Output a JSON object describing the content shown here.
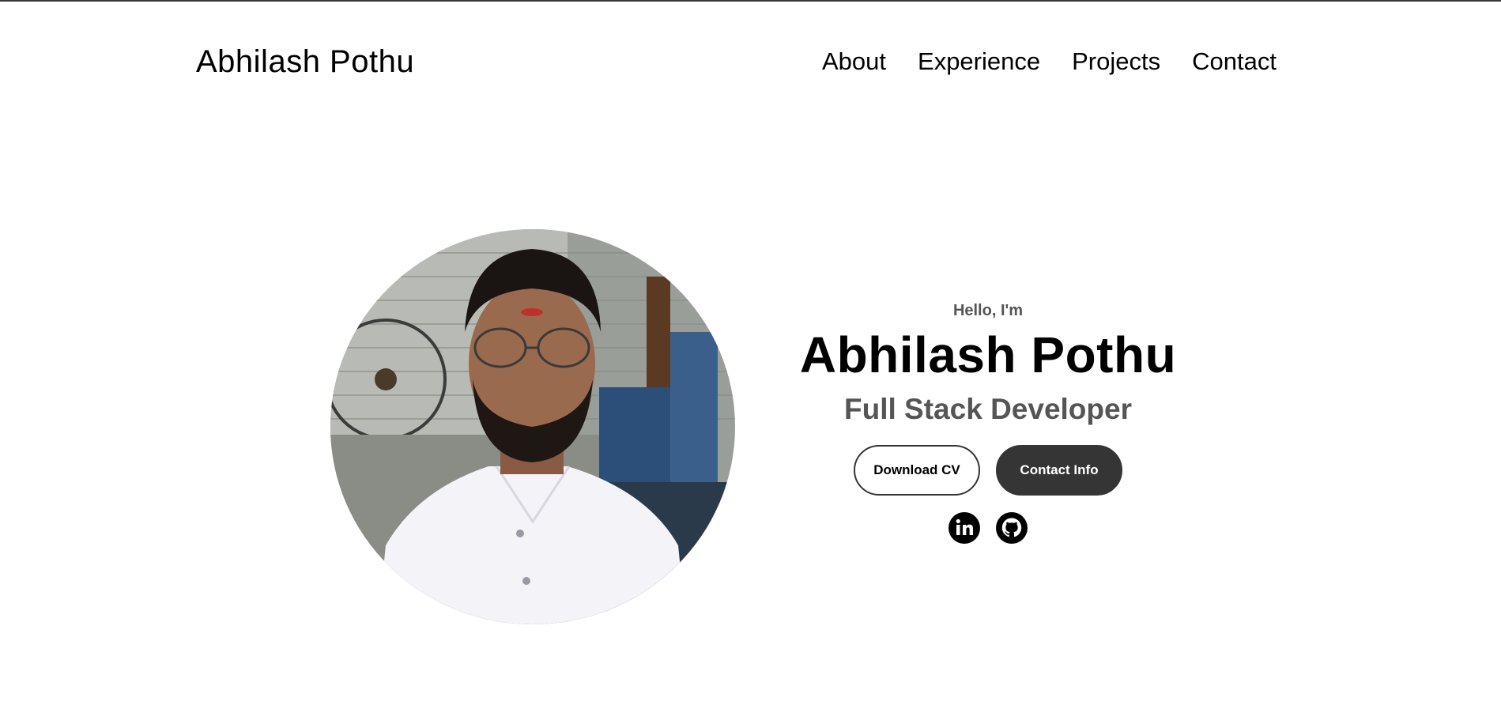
{
  "header": {
    "brand": "Abhilash Pothu",
    "nav": [
      {
        "label": "About"
      },
      {
        "label": "Experience"
      },
      {
        "label": "Projects"
      },
      {
        "label": "Contact"
      }
    ]
  },
  "hero": {
    "greeting": "Hello, I'm",
    "name": "Abhilash Pothu",
    "role": "Full Stack Developer",
    "buttons": {
      "download_cv": "Download CV",
      "contact_info": "Contact Info"
    },
    "socials": [
      {
        "icon": "linkedin-icon"
      },
      {
        "icon": "github-icon"
      }
    ],
    "photo": {
      "icon": "profile-photo"
    }
  },
  "colors": {
    "primary_dark": "#353535",
    "muted_text": "#555555",
    "background": "#ffffff"
  }
}
